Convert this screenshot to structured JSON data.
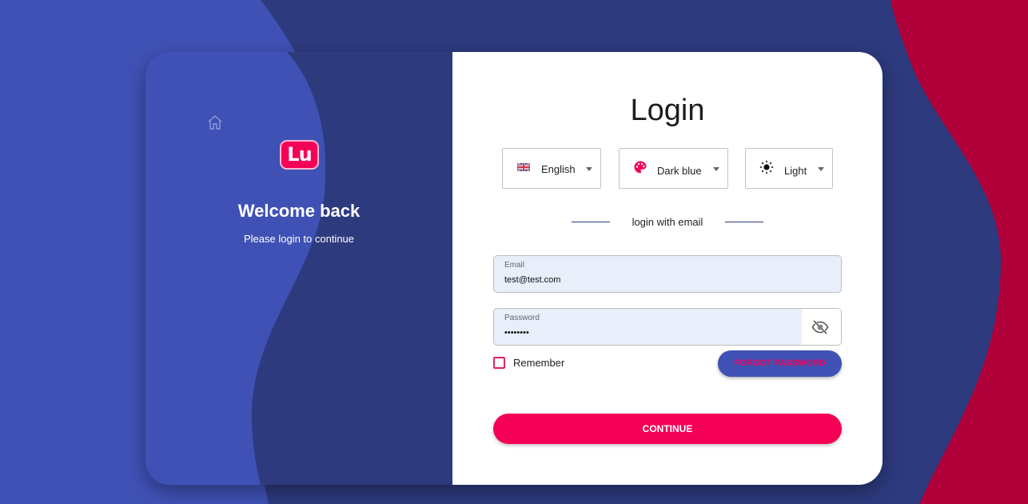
{
  "colors": {
    "background_dark": "#2d3a7e",
    "background_light": "#3f51b5",
    "accent_pink": "#f50057",
    "accent_crimson": "#b0003a",
    "input_fill": "#e8eefa"
  },
  "sidebar": {
    "home_icon": "home-icon",
    "logo_text": "Lu",
    "welcome": "Welcome back",
    "subtitle": "Please login to continue"
  },
  "form": {
    "title": "Login",
    "selectors": {
      "language": {
        "value": "English",
        "icon": "uk-flag-icon"
      },
      "theme": {
        "value": "Dark blue",
        "icon": "palette-icon"
      },
      "mode": {
        "value": "Light",
        "icon": "sun-icon"
      }
    },
    "divider_text": "login with email",
    "email": {
      "label": "Email",
      "value": "test@test.com"
    },
    "password": {
      "label": "Password",
      "value": "••••••••",
      "toggle_icon": "eye-off-icon"
    },
    "remember_label": "Remember",
    "forgot_label": "FORGOT PASSWORD",
    "continue_label": "CONTINUE"
  }
}
